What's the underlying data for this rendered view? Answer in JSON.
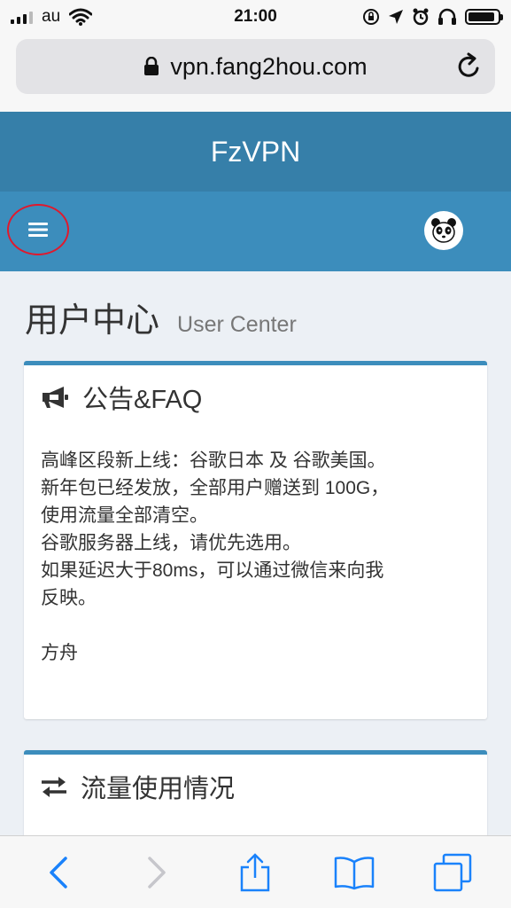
{
  "status_bar": {
    "carrier": "au",
    "time": "21:00",
    "battery_level": 0.9
  },
  "browser": {
    "url": "vpn.fang2hou.com"
  },
  "app": {
    "title": "FzVPN"
  },
  "page": {
    "title": "用户中心",
    "subtitle": "User Center"
  },
  "announcement": {
    "title": "公告&FAQ",
    "lines": [
      "高峰区段新上线：谷歌日本 及 谷歌美国。",
      "新年包已经发放，全部用户赠送到 100G，",
      "使用流量全部清空。",
      "谷歌服务器上线，请优先选用。",
      "如果延迟大于80ms，可以通过微信来向我",
      "反映。"
    ],
    "signature": "方舟"
  },
  "traffic": {
    "title": "流量使用情况"
  },
  "colors": {
    "header_dark": "#367fa9",
    "header_light": "#3c8dbc",
    "highlight_circle": "#e0192d",
    "ios_blue": "#1a82fb"
  }
}
